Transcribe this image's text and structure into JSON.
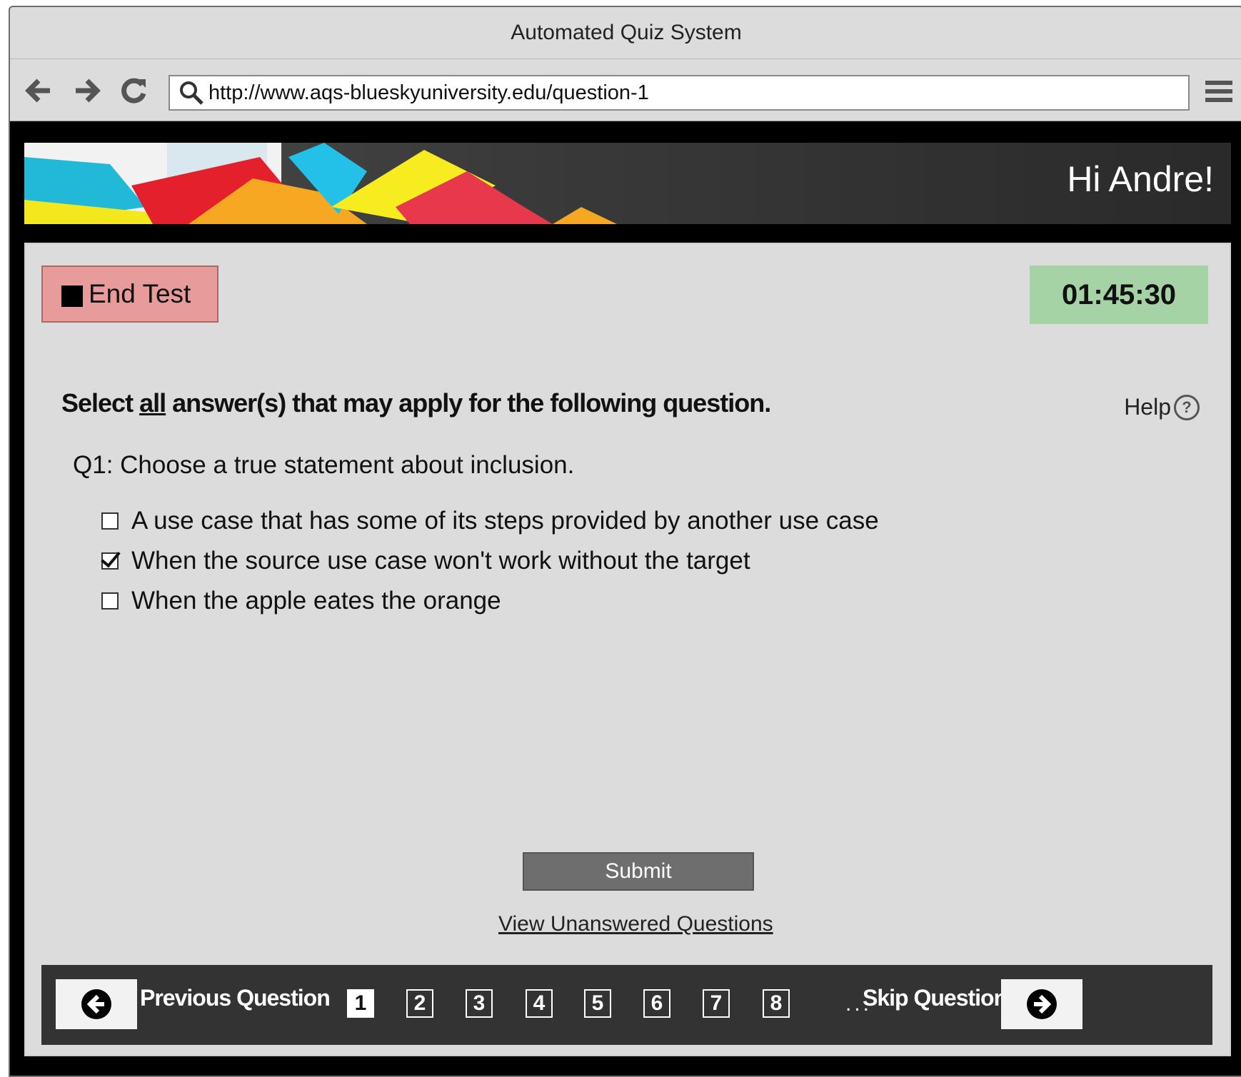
{
  "window": {
    "title": "Automated Quiz System"
  },
  "browser": {
    "url": "http://www.aqs-blueskyuniversity.edu/question-1"
  },
  "header": {
    "greeting": "Hi Andre!"
  },
  "controls": {
    "end_test_label": "End Test",
    "timer": "01:45:30"
  },
  "instructions": {
    "before": "Select ",
    "emphasis": "all",
    "after": " answer(s) that may apply for the following question.",
    "help_label": "Help"
  },
  "question": {
    "text": "Q1: Choose a true statement about inclusion.",
    "options": [
      {
        "label": "A use case that has some of its steps provided by another use case",
        "checked": false
      },
      {
        "label": "When the source use case won't work without the target",
        "checked": true
      },
      {
        "label": "When the apple eates the orange",
        "checked": false
      }
    ]
  },
  "actions": {
    "submit_label": "Submit",
    "view_unanswered_label": "View Unanswered Questions"
  },
  "pager": {
    "previous_label": "Previous Question",
    "skip_label": "Skip Question",
    "pages": [
      "1",
      "2",
      "3",
      "4",
      "5",
      "6",
      "7",
      "8"
    ],
    "active_page": "1",
    "ellipsis": "..."
  },
  "icons": {
    "back": "arrow-left-icon",
    "forward": "arrow-right-icon",
    "reload": "reload-icon",
    "search": "search-icon",
    "menu": "hamburger-menu-icon",
    "help": "question-circle-icon",
    "prev": "circle-arrow-left-icon",
    "next": "circle-arrow-right-icon"
  },
  "colors": {
    "end_test_bg": "#e89b9b",
    "timer_bg": "#a6d3a6",
    "pager_bg": "#333333",
    "submit_bg": "#6e6e6e"
  }
}
